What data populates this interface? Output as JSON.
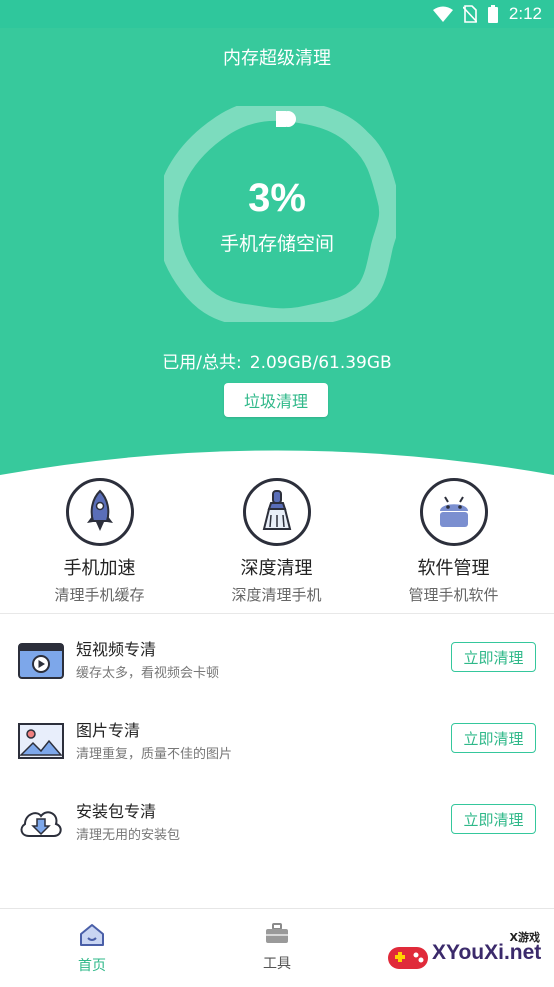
{
  "status_bar": {
    "time": "2:12",
    "bg_color": "#2fc79c"
  },
  "header": {
    "title": "内存超级清理"
  },
  "gauge": {
    "percent_text": "3%",
    "percent_value": 3,
    "label": "手机存储空间"
  },
  "storage": {
    "label": "已用/总共:",
    "used": "2.09GB",
    "separator": "/",
    "total": "61.39GB"
  },
  "clean_button": {
    "label": "垃圾清理"
  },
  "features": [
    {
      "icon": "rocket-icon",
      "title": "手机加速",
      "subtitle": "清理手机缓存"
    },
    {
      "icon": "broom-icon",
      "title": "深度清理",
      "subtitle": "深度清理手机"
    },
    {
      "icon": "android-icon",
      "title": "软件管理",
      "subtitle": "管理手机软件"
    }
  ],
  "clean_items": [
    {
      "icon": "video-icon",
      "title": "短视频专清",
      "subtitle": "缓存太多，看视频会卡顿",
      "button": "立即清理"
    },
    {
      "icon": "image-icon",
      "title": "图片专清",
      "subtitle": "清理重复，质量不佳的图片",
      "button": "立即清理"
    },
    {
      "icon": "cloud-download-icon",
      "title": "安装包专清",
      "subtitle": "清理无用的安装包",
      "button": "立即清理"
    }
  ],
  "bottom_nav": [
    {
      "icon": "home-icon",
      "label": "首页",
      "active": true
    },
    {
      "icon": "toolbox-icon",
      "label": "工具",
      "active": false
    }
  ],
  "watermark": {
    "small_text": "X游戏",
    "text": "XYouXi.net"
  },
  "colors": {
    "accent": "#37c99c",
    "accent_dark": "#2fb889",
    "nav_active": "#2fb889",
    "nav_inactive": "#555555"
  }
}
